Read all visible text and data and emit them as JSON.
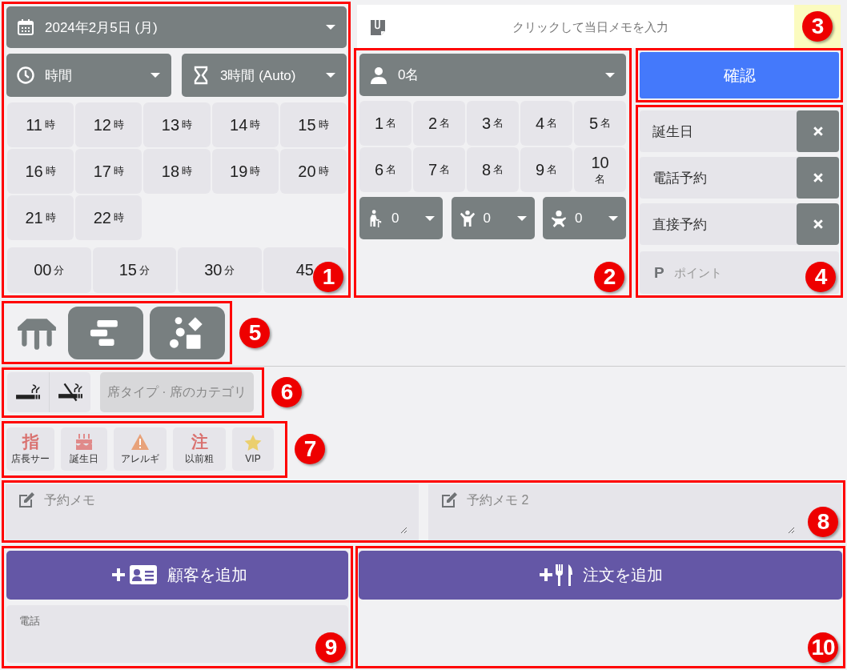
{
  "date_select": {
    "label": "2024年2月5日 (月)"
  },
  "time_select": {
    "label": "時間"
  },
  "duration_select": {
    "label": "3時間 (Auto)"
  },
  "hours": [
    {
      "number": "11",
      "unit": "時"
    },
    {
      "number": "12",
      "unit": "時"
    },
    {
      "number": "13",
      "unit": "時"
    },
    {
      "number": "14",
      "unit": "時"
    },
    {
      "number": "15",
      "unit": "時"
    },
    {
      "number": "16",
      "unit": "時"
    },
    {
      "number": "17",
      "unit": "時"
    },
    {
      "number": "18",
      "unit": "時"
    },
    {
      "number": "19",
      "unit": "時"
    },
    {
      "number": "20",
      "unit": "時"
    },
    {
      "number": "21",
      "unit": "時"
    },
    {
      "number": "22",
      "unit": "時"
    }
  ],
  "minutes": [
    {
      "number": "00",
      "unit": "分"
    },
    {
      "number": "15",
      "unit": "分"
    },
    {
      "number": "30",
      "unit": "分"
    },
    {
      "number": "45"
    }
  ],
  "day_memo": {
    "placeholder": "クリックして当日メモを入力"
  },
  "party_select": {
    "label": "0名"
  },
  "party_sizes": [
    {
      "number": "1",
      "unit": "名"
    },
    {
      "number": "2",
      "unit": "名"
    },
    {
      "number": "3",
      "unit": "名"
    },
    {
      "number": "4",
      "unit": "名"
    },
    {
      "number": "5",
      "unit": "名"
    },
    {
      "number": "6",
      "unit": "名"
    },
    {
      "number": "7",
      "unit": "名"
    },
    {
      "number": "8",
      "unit": "名"
    },
    {
      "number": "9",
      "unit": "名"
    },
    {
      "number": "10",
      "unit": "名"
    }
  ],
  "age_selects": [
    {
      "kind": "senior",
      "value": "0"
    },
    {
      "kind": "child",
      "value": "0"
    },
    {
      "kind": "baby",
      "value": "0"
    }
  ],
  "confirm_button": "確認",
  "tags": [
    "誕生日",
    "電話予約",
    "直接予約"
  ],
  "points": {
    "icon_label": "P",
    "placeholder": "ポイント"
  },
  "view_modes": [
    {
      "kind": "table",
      "selected": true
    },
    {
      "kind": "bars",
      "selected": false
    },
    {
      "kind": "shapes",
      "selected": false
    }
  ],
  "seat_type": {
    "placeholder": "席タイプ · 席のカテゴリ"
  },
  "flags": [
    {
      "kind": "glyph",
      "glyph": "指",
      "label": "店長サー",
      "color": "#d9716f"
    },
    {
      "kind": "cake",
      "label": "誕生日",
      "color": "#e08a8a"
    },
    {
      "kind": "warning",
      "label": "アレルギ",
      "color": "#e8a27a"
    },
    {
      "kind": "glyph",
      "glyph": "注",
      "label": "以前粗",
      "color": "#d9716f"
    },
    {
      "kind": "star",
      "label": "VIP",
      "color": "#ebcf6e"
    }
  ],
  "memos": [
    {
      "placeholder": "予約メモ"
    },
    {
      "placeholder": "予約メモ 2"
    }
  ],
  "add_customer_button": "顧客を追加",
  "phone_field": {
    "placeholder": "電話"
  },
  "add_order_button": "注文を追加",
  "callouts": [
    "1",
    "2",
    "3",
    "4",
    "5",
    "6",
    "7",
    "8",
    "9",
    "10"
  ]
}
